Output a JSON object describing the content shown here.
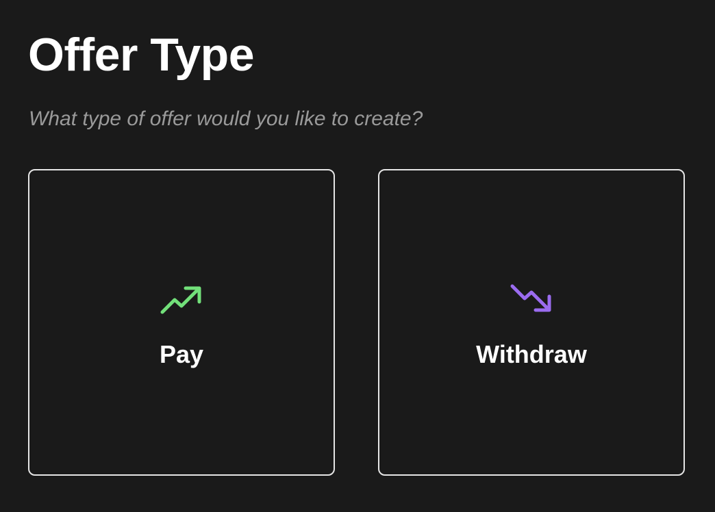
{
  "header": {
    "title": "Offer Type",
    "subtitle": "What type of offer would you like to create?"
  },
  "options": [
    {
      "label": "Pay",
      "icon": "trending-up-icon",
      "icon_color": "#72e07a"
    },
    {
      "label": "Withdraw",
      "icon": "trending-down-icon",
      "icon_color": "#9b6cf0"
    }
  ],
  "colors": {
    "background": "#1a1a1a",
    "card_border": "#e6e6e6",
    "title_text": "#ffffff",
    "subtitle_text": "#9a9a9a"
  }
}
